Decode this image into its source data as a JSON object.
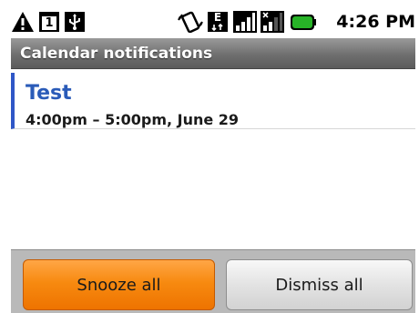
{
  "status_bar": {
    "time": "4:26 PM",
    "icons": [
      "warning-icon",
      "calendar-day-icon",
      "usb-icon",
      "vibrate-icon",
      "edge-data-icon",
      "signal-icon",
      "roaming-signal-icon",
      "battery-icon"
    ],
    "calendar_day": "1",
    "data_type": "E",
    "battery_color": "#27b327"
  },
  "header": {
    "title": "Calendar notifications"
  },
  "notifications": [
    {
      "title": "Test",
      "time": "4:00pm – 5:00pm, June 29"
    }
  ],
  "actions": {
    "snooze_label": "Snooze all",
    "dismiss_label": "Dismiss all"
  },
  "colors": {
    "accent": "#2f57c7",
    "snooze_button": "#f78a10"
  }
}
